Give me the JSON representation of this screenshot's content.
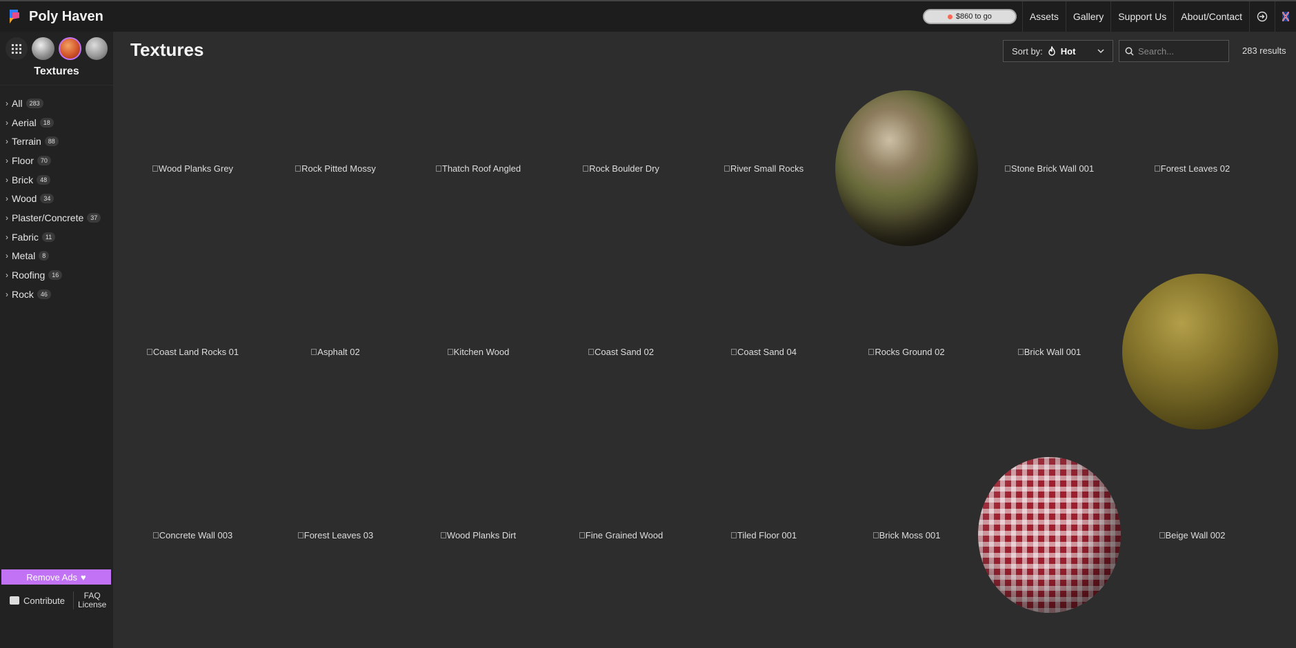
{
  "header": {
    "site_name": "Poly Haven",
    "progress_text": "$860 to go",
    "nav": [
      "Assets",
      "Gallery",
      "Support Us",
      "About/Contact"
    ]
  },
  "sidebar": {
    "title": "Textures",
    "categories": [
      {
        "label": "All",
        "count": "283"
      },
      {
        "label": "Aerial",
        "count": "18"
      },
      {
        "label": "Terrain",
        "count": "88"
      },
      {
        "label": "Floor",
        "count": "70"
      },
      {
        "label": "Brick",
        "count": "48"
      },
      {
        "label": "Wood",
        "count": "34"
      },
      {
        "label": "Plaster/Concrete",
        "count": "37"
      },
      {
        "label": "Fabric",
        "count": "11"
      },
      {
        "label": "Metal",
        "count": "8"
      },
      {
        "label": "Roofing",
        "count": "16"
      },
      {
        "label": "Rock",
        "count": "46"
      }
    ],
    "remove_ads": "Remove Ads",
    "contribute": "Contribute",
    "faq": "FAQ",
    "license": "License"
  },
  "main": {
    "title": "Textures",
    "sort_label": "Sort by:",
    "sort_value": "Hot",
    "search_placeholder": "Search...",
    "results": "283 results"
  },
  "assets": [
    "Wood Planks Grey",
    "Rock Pitted Mossy",
    "Thatch Roof Angled",
    "Rock Boulder Dry",
    "River Small Rocks",
    "",
    "Stone Brick Wall 001",
    "Forest Leaves 02",
    "Coast Land Rocks 01",
    "Asphalt 02",
    "Kitchen Wood",
    "Coast Sand 02",
    "Coast Sand 04",
    "Rocks Ground 02",
    "Brick Wall 001",
    "",
    "Concrete Wall 003",
    "Forest Leaves 03",
    "Wood Planks Dirt",
    "Fine Grained Wood",
    "Tiled Floor 001",
    "Brick Moss 001",
    "",
    "Beige Wall 002"
  ],
  "colors": {
    "topbar_bg": "#1d1d1d",
    "sidebar_bg": "#222222",
    "main_bg": "#2d2d2d",
    "accent_purple": "#c272f5",
    "patreon_red": "#f96854"
  }
}
